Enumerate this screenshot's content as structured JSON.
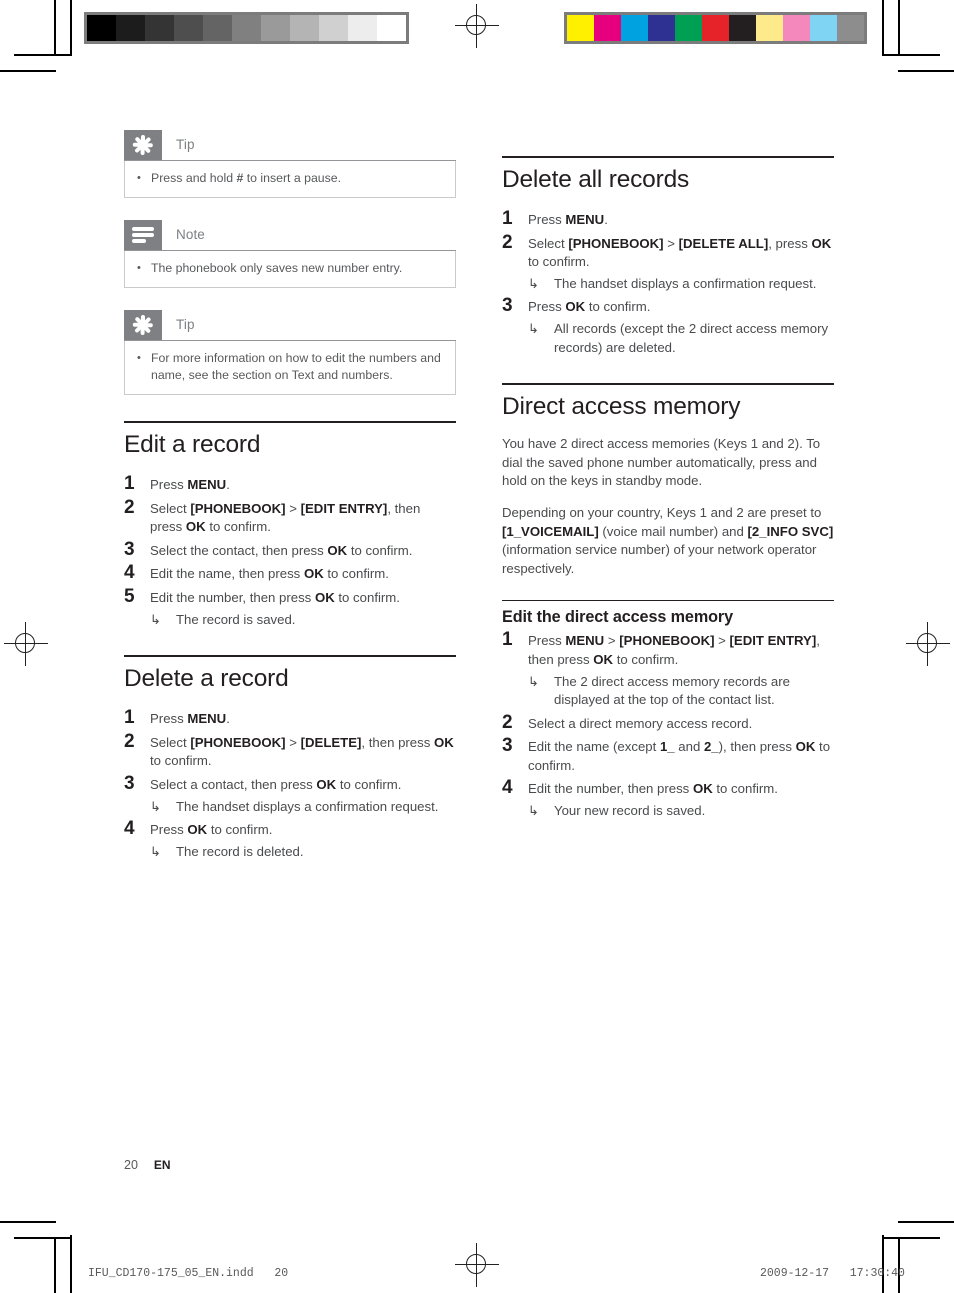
{
  "document": {
    "page_number": "20",
    "language_code": "EN",
    "print_filename": "IFU_CD170-175_05_EN.indd",
    "print_page": "20",
    "print_date": "2009-12-17",
    "print_time": "17:30:40"
  },
  "calibration": {
    "grayscale_label": "grayscale-strip",
    "grayscale": [
      "#000000",
      "#1c1c1c",
      "#343434",
      "#4e4e4e",
      "#646464",
      "#808080",
      "#9a9a9a",
      "#b4b4b4",
      "#d0d0d0",
      "#ededed",
      "#ffffff"
    ],
    "color_label": "color-strip",
    "color": [
      "#fff000",
      "#e6007e",
      "#00a3e0",
      "#2e3192",
      "#00a054",
      "#e62329",
      "#231f20",
      "#fdeb8b",
      "#f488bd",
      "#7fd4f4",
      "#8d8d8d"
    ]
  },
  "callouts": [
    {
      "icon": "asterisk-icon",
      "type": "tip",
      "title": "Tip",
      "items": [
        {
          "prefix": "Press and hold ",
          "glyph": "#",
          "suffix": " to insert a pause."
        }
      ]
    },
    {
      "icon": "note-lines-icon",
      "type": "note",
      "title": "Note",
      "items": [
        {
          "prefix": "The phonebook only saves new number entry.",
          "glyph": "",
          "suffix": ""
        }
      ]
    },
    {
      "icon": "asterisk-icon",
      "type": "tip",
      "title": "Tip",
      "items": [
        {
          "prefix": "For more information on how to edit the numbers and name, see the section on Text and numbers.",
          "glyph": "",
          "suffix": ""
        }
      ]
    }
  ],
  "bullet": "•",
  "arrow": "↳",
  "left_column": {
    "sections": [
      {
        "heading": "Edit a record",
        "level": 1,
        "steps": [
          {
            "num": "1",
            "parts": [
              {
                "t": "Press ",
                "b": false
              },
              {
                "t": "MENU",
                "b": true
              },
              {
                "t": ".",
                "b": false
              }
            ],
            "notes": []
          },
          {
            "num": "2",
            "parts": [
              {
                "t": "Select ",
                "b": false
              },
              {
                "t": "[PHONEBOOK]",
                "b": true
              },
              {
                "t": " > ",
                "b": false
              },
              {
                "t": "[EDIT ENTRY]",
                "b": true
              },
              {
                "t": ", then press ",
                "b": false
              },
              {
                "t": "OK",
                "b": true
              },
              {
                "t": " to confirm.",
                "b": false
              }
            ],
            "notes": []
          },
          {
            "num": "3",
            "parts": [
              {
                "t": "Select the contact, then press ",
                "b": false
              },
              {
                "t": "OK",
                "b": true
              },
              {
                "t": " to confirm.",
                "b": false
              }
            ],
            "notes": []
          },
          {
            "num": "4",
            "parts": [
              {
                "t": "Edit the name, then press ",
                "b": false
              },
              {
                "t": "OK",
                "b": true
              },
              {
                "t": " to confirm.",
                "b": false
              }
            ],
            "notes": []
          },
          {
            "num": "5",
            "parts": [
              {
                "t": "Edit the number, then press ",
                "b": false
              },
              {
                "t": "OK",
                "b": true
              },
              {
                "t": " to confirm.",
                "b": false
              }
            ],
            "notes": [
              "The record is saved."
            ]
          }
        ]
      },
      {
        "heading": "Delete a record",
        "level": 1,
        "steps": [
          {
            "num": "1",
            "parts": [
              {
                "t": "Press ",
                "b": false
              },
              {
                "t": "MENU",
                "b": true
              },
              {
                "t": ".",
                "b": false
              }
            ],
            "notes": []
          },
          {
            "num": "2",
            "parts": [
              {
                "t": "Select ",
                "b": false
              },
              {
                "t": "[PHONEBOOK]",
                "b": true
              },
              {
                "t": " > ",
                "b": false
              },
              {
                "t": "[DELETE]",
                "b": true
              },
              {
                "t": ", then press ",
                "b": false
              },
              {
                "t": "OK",
                "b": true
              },
              {
                "t": " to confirm.",
                "b": false
              }
            ],
            "notes": []
          },
          {
            "num": "3",
            "parts": [
              {
                "t": "Select a contact, then press ",
                "b": false
              },
              {
                "t": "OK",
                "b": true
              },
              {
                "t": " to confirm.",
                "b": false
              }
            ],
            "notes": [
              "The handset displays a confirmation request."
            ]
          },
          {
            "num": "4",
            "parts": [
              {
                "t": "Press ",
                "b": false
              },
              {
                "t": "OK",
                "b": true
              },
              {
                "t": " to confirm.",
                "b": false
              }
            ],
            "notes": [
              "The record is deleted."
            ]
          }
        ]
      }
    ]
  },
  "right_column": {
    "sections": [
      {
        "heading": "Delete all records",
        "level": 1,
        "paragraphs": [],
        "steps": [
          {
            "num": "1",
            "parts": [
              {
                "t": "Press ",
                "b": false
              },
              {
                "t": "MENU",
                "b": true
              },
              {
                "t": ".",
                "b": false
              }
            ],
            "notes": []
          },
          {
            "num": "2",
            "parts": [
              {
                "t": "Select ",
                "b": false
              },
              {
                "t": "[PHONEBOOK]",
                "b": true
              },
              {
                "t": " > ",
                "b": false
              },
              {
                "t": "[DELETE ALL]",
                "b": true
              },
              {
                "t": ", press ",
                "b": false
              },
              {
                "t": "OK",
                "b": true
              },
              {
                "t": " to confirm.",
                "b": false
              }
            ],
            "notes": [
              "The handset displays a confirmation request."
            ]
          },
          {
            "num": "3",
            "parts": [
              {
                "t": "Press ",
                "b": false
              },
              {
                "t": "OK",
                "b": true
              },
              {
                "t": " to confirm.",
                "b": false
              }
            ],
            "notes": [
              "All records (except the 2 direct access memory records) are deleted."
            ]
          }
        ]
      },
      {
        "heading": "Direct access memory",
        "level": 1,
        "paragraphs": [
          [
            {
              "t": "You have 2 direct access memories (Keys 1 and 2). To dial the saved phone number automatically, press and hold on the keys in standby mode.",
              "b": false
            }
          ],
          [
            {
              "t": "Depending on your country, Keys 1 and 2 are preset to ",
              "b": false
            },
            {
              "t": "[1_VOICEMAIL]",
              "b": true
            },
            {
              "t": " (voice mail number) and ",
              "b": false
            },
            {
              "t": "[2_INFO SVC]",
              "b": true
            },
            {
              "t": " (information service number) of your network operator respectively.",
              "b": false
            }
          ]
        ],
        "steps": []
      },
      {
        "heading": "Edit the direct access memory",
        "level": 2,
        "paragraphs": [],
        "steps": [
          {
            "num": "1",
            "parts": [
              {
                "t": "Press ",
                "b": false
              },
              {
                "t": "MENU",
                "b": true
              },
              {
                "t": " > ",
                "b": false
              },
              {
                "t": "[PHONEBOOK]",
                "b": true
              },
              {
                "t": " > ",
                "b": false
              },
              {
                "t": "[EDIT ENTRY]",
                "b": true
              },
              {
                "t": ", then press ",
                "b": false
              },
              {
                "t": "OK",
                "b": true
              },
              {
                "t": " to confirm.",
                "b": false
              }
            ],
            "notes": [
              "The 2 direct access memory records are displayed at the top of the contact list."
            ]
          },
          {
            "num": "2",
            "parts": [
              {
                "t": "Select a direct memory access record.",
                "b": false
              }
            ],
            "notes": []
          },
          {
            "num": "3",
            "parts": [
              {
                "t": "Edit the name (except ",
                "b": false
              },
              {
                "t": "1_",
                "b": true
              },
              {
                "t": " and ",
                "b": false
              },
              {
                "t": "2_",
                "b": true
              },
              {
                "t": "), then press ",
                "b": false
              },
              {
                "t": "OK",
                "b": true
              },
              {
                "t": " to confirm.",
                "b": false
              }
            ],
            "notes": []
          },
          {
            "num": "4",
            "parts": [
              {
                "t": "Edit the number, then press ",
                "b": false
              },
              {
                "t": "OK",
                "b": true
              },
              {
                "t": " to confirm.",
                "b": false
              }
            ],
            "notes": [
              "Your new record is saved."
            ]
          }
        ]
      }
    ]
  }
}
